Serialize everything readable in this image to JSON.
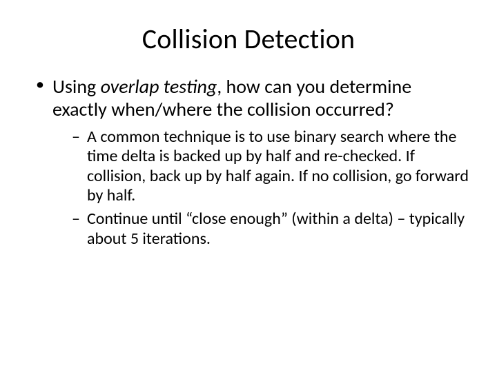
{
  "title": "Collision Detection",
  "bullet": {
    "pre": "Using ",
    "italic": "overlap testing",
    "post": ", how can you determine exactly when/where the collision occurred?"
  },
  "sub": [
    "A common technique is to use binary search where the time delta is backed up by half and re-checked.  If collision, back up by half again.  If no collision, go forward by half.",
    "Continue until “close enough” (within a delta) – typically about 5 iterations."
  ]
}
